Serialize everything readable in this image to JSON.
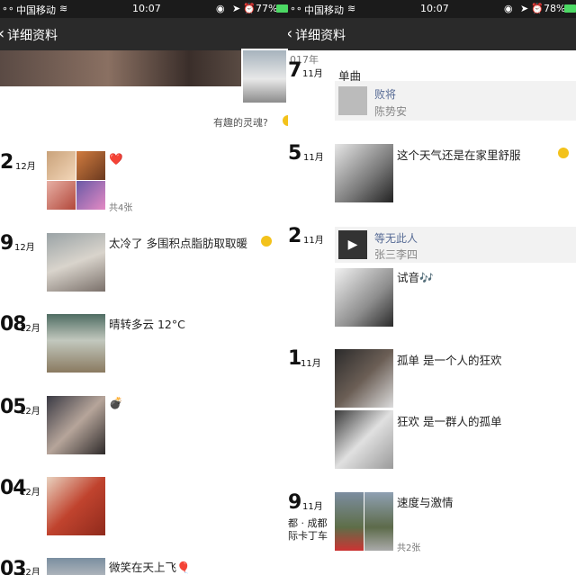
{
  "left": {
    "status": {
      "carrier": "中国移动",
      "time": "10:07",
      "battery": "77%"
    },
    "nav": {
      "title": "详细资料"
    },
    "cover_caption": "有趣的灵魂?",
    "posts": [
      {
        "day": "2",
        "month": "12月",
        "text": "❤️",
        "count": "共4张"
      },
      {
        "day": "9",
        "month": "12月",
        "text": "太冷了 多围积点脂肪取取暖"
      },
      {
        "day": "08",
        "month": "12月",
        "text": "晴转多云 12°C"
      },
      {
        "day": "05",
        "month": "12月",
        "text": "💣"
      },
      {
        "day": "04",
        "month": "12月",
        "text": ""
      },
      {
        "day": "03",
        "month": "12月",
        "text": "微笑在天上飞🎈"
      }
    ]
  },
  "right": {
    "status": {
      "carrier": "中国移动",
      "time": "10:07",
      "battery": "78%"
    },
    "nav": {
      "title": "详细资料"
    },
    "year": "017年",
    "posts": [
      {
        "day": "7",
        "month": "11月",
        "share_header": "单曲",
        "share_title": "败将",
        "share_artist": "陈势安"
      },
      {
        "day": "5",
        "month": "11月",
        "text": "这个天气还是在家里舒服"
      },
      {
        "day": "2",
        "month": "11月",
        "share_title": "等无此人",
        "share_artist": "张三李四",
        "text": "试音🎶"
      },
      {
        "day": "1",
        "month": "11月",
        "text": "孤单 是一个人的狂欢",
        "text2": "狂欢 是一群人的孤单"
      },
      {
        "day": "9",
        "month": "11月",
        "location1": "都 · 成都",
        "location2": "际卡丁车",
        "text": "速度与激情",
        "count": "共2张"
      }
    ]
  }
}
